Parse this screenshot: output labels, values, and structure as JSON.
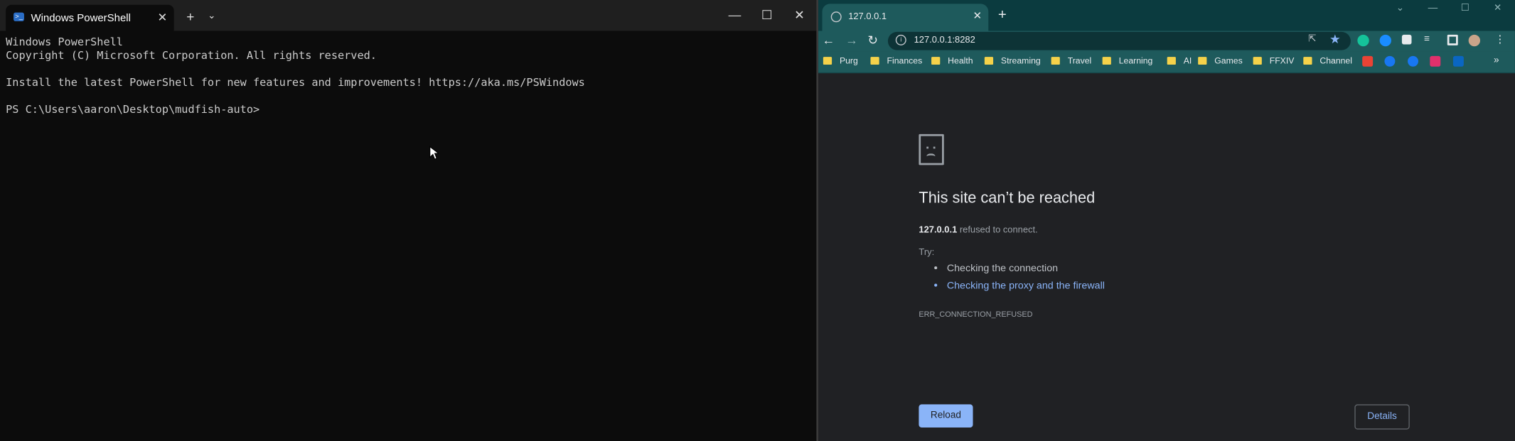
{
  "terminal": {
    "tab_title": "Windows PowerShell",
    "tab_close": "✕",
    "new_tab": "+",
    "dropdown": "⌄",
    "minimize": "—",
    "maximize": "☐",
    "close": "✕",
    "lines": [
      "Windows PowerShell",
      "Copyright (C) Microsoft Corporation. All rights reserved.",
      "",
      "Install the latest PowerShell for new features and improvements! https://aka.ms/PSWindows",
      "",
      "PS C:\\Users\\aaron\\Desktop\\mudfish-auto>"
    ]
  },
  "browser": {
    "tab_title": "127.0.0.1",
    "tab_close": "✕",
    "new_tab": "+",
    "window_controls": {
      "chevron": "⌄",
      "minimize": "—",
      "maximize": "☐",
      "close": "✕"
    },
    "nav": {
      "back": "←",
      "forward": "→",
      "reload": "↻"
    },
    "url": "127.0.0.1:8282",
    "bookmarks": [
      "Purg",
      "Finances",
      "Health",
      "Streaming",
      "Travel",
      "Learning",
      "AI",
      "Games",
      "FFXIV",
      "Channel"
    ],
    "bookmark_more": "»",
    "extension_colors": {
      "grammarly": "#15c39a",
      "onepassword": "#1a8cff",
      "puzzle": "#e8eaed",
      "avatar": "#c9a48a"
    },
    "bookmark_icon_colors": {
      "gmail": "#ea4335",
      "messenger": "#1877f2",
      "facebook": "#1877f2",
      "instagram": "#e1306c",
      "linkedin": "#0a66c2"
    },
    "error": {
      "title": "This site can’t be reached",
      "host": "127.0.0.1",
      "desc_suffix": " refused to connect.",
      "try_label": "Try:",
      "suggestions": [
        "Checking the connection",
        "Checking the proxy and the firewall"
      ],
      "code": "ERR_CONNECTION_REFUSED",
      "reload_label": "Reload",
      "details_label": "Details"
    }
  }
}
